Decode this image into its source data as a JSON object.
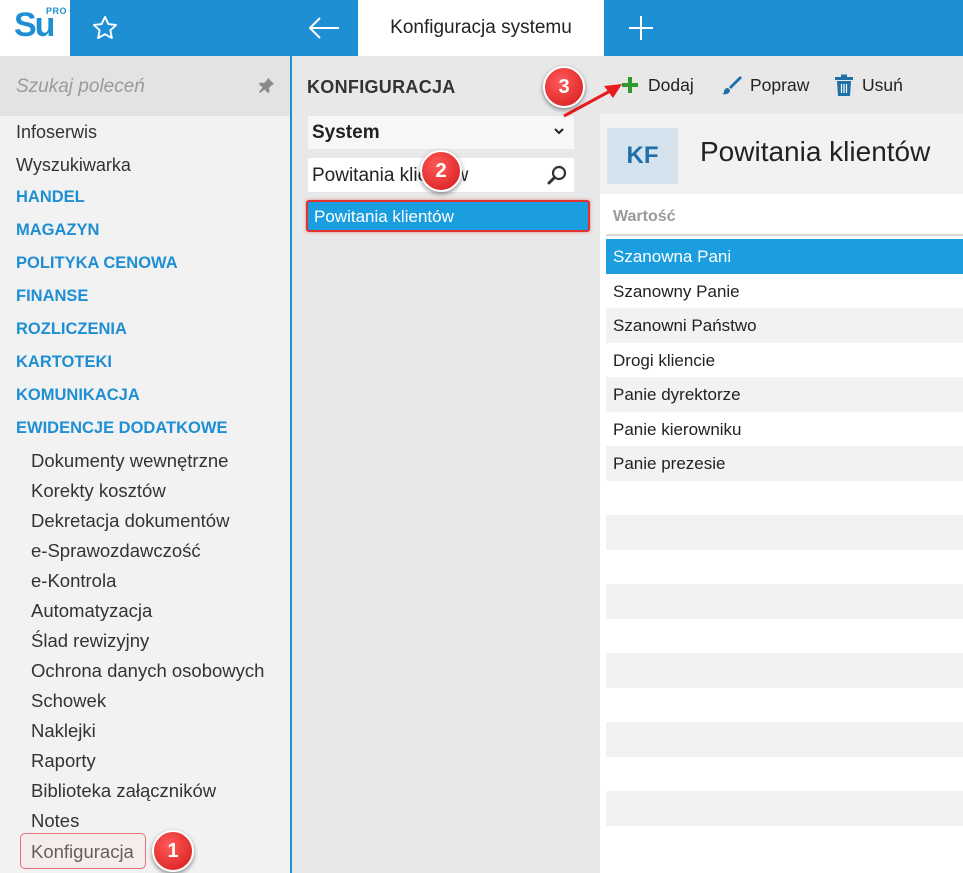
{
  "app": {
    "logo_text": "Su",
    "logo_sup": "PRO",
    "active_tab": "Konfiguracja systemu"
  },
  "icons": {
    "star": "star-icon",
    "back": "arrow-left-icon",
    "new_tab": "plus-icon",
    "pin": "pin-icon",
    "search": "magnifier-icon",
    "add": "plus-icon",
    "edit": "brush-icon",
    "delete": "trash-icon"
  },
  "sidebar": {
    "search_placeholder": "Szukaj poleceń",
    "top_items": [
      "Infoserwis",
      "Wyszukiwarka"
    ],
    "sections": [
      "HANDEL",
      "MAGAZYN",
      "POLITYKA CENOWA",
      "FINANSE",
      "ROZLICZENIA",
      "KARTOTEKI",
      "KOMUNIKACJA",
      "EWIDENCJE DODATKOWE"
    ],
    "sub_items": [
      "Dokumenty wewnętrzne",
      "Korekty kosztów",
      "Dekretacja dokumentów",
      "e-Sprawozdawczość",
      "e-Kontrola",
      "Automatyzacja",
      "Ślad rewizyjny",
      "Ochrona danych osobowych",
      "Schowek",
      "Naklejki",
      "Raporty",
      "Biblioteka załączników",
      "Notes",
      "Konfiguracja"
    ]
  },
  "middle": {
    "title": "KONFIGURACJA",
    "select_value": "System",
    "filter_value": "Powitania klientów",
    "list_items": [
      "Powitania klientów"
    ]
  },
  "toolbar": {
    "add_label": "Dodaj",
    "edit_label": "Popraw",
    "delete_label": "Usuń"
  },
  "detail": {
    "badge": "KF",
    "title": "Powitania klientów",
    "column_header": "Wartość",
    "rows": [
      "Szanowna Pani",
      "Szanowny Panie",
      "Szanowni Państwo",
      "Drogi kliencie",
      "Panie dyrektorze",
      "Panie kierowniku",
      "Panie prezesie"
    ]
  },
  "annotations": [
    "1",
    "2",
    "3"
  ],
  "colors": {
    "brand_blue": "#1f8fd4",
    "selection_blue": "#1a9ee0",
    "annotation_red": "#d41818",
    "add_green": "#2e9a2e"
  }
}
